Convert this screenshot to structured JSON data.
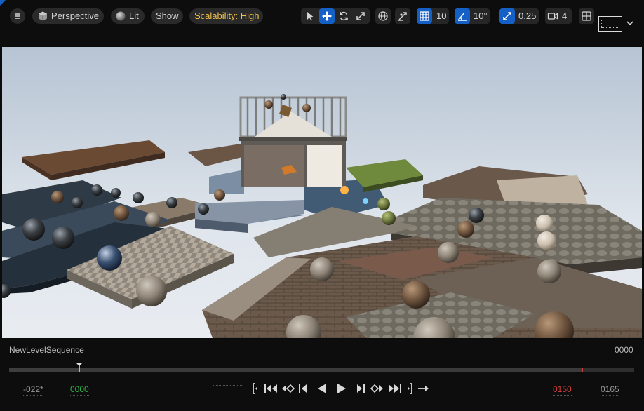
{
  "toolbar": {
    "menu_icon": "hamburger-menu-icon",
    "view_mode_label": "Perspective",
    "view_mode_icon": "cube-icon",
    "lighting_label": "Lit",
    "lighting_icon": "sphere-icon",
    "show_label": "Show",
    "scalability_label": "Scalability: High",
    "scalability_color": "#f2c24a",
    "transform_tools": [
      {
        "name": "select-arrow-icon",
        "active": false
      },
      {
        "name": "move-icon",
        "active": true
      },
      {
        "name": "rotate-icon",
        "active": false
      },
      {
        "name": "scale-icon",
        "active": false
      }
    ],
    "world_local_icon": "globe-icon",
    "surface_snap_icon": "surface-snap-icon",
    "grid_snap_value": "10",
    "rotation_snap_value": "10°",
    "scale_snap_value": "0.25",
    "camera_speed_value": "4",
    "layout_icon": "viewport-layout-icon",
    "accent_color": "#1560c6"
  },
  "sequencer": {
    "sequence_name": "NewLevelSequence",
    "current_frame": "0000",
    "view_start": "-022*",
    "play_start": "0000",
    "play_end": "0150",
    "view_end": "0165",
    "start_color": "#2fb34a",
    "end_color": "#d23b3b",
    "playhead_progress": 0.112,
    "transport_buttons": [
      "set-start-icon",
      "jump-to-start-icon",
      "previous-key-icon",
      "step-back-icon",
      "play-reverse-icon",
      "play-icon",
      "step-forward-icon",
      "next-key-icon",
      "jump-to-end-icon",
      "set-end-icon",
      "loop-icon"
    ]
  }
}
